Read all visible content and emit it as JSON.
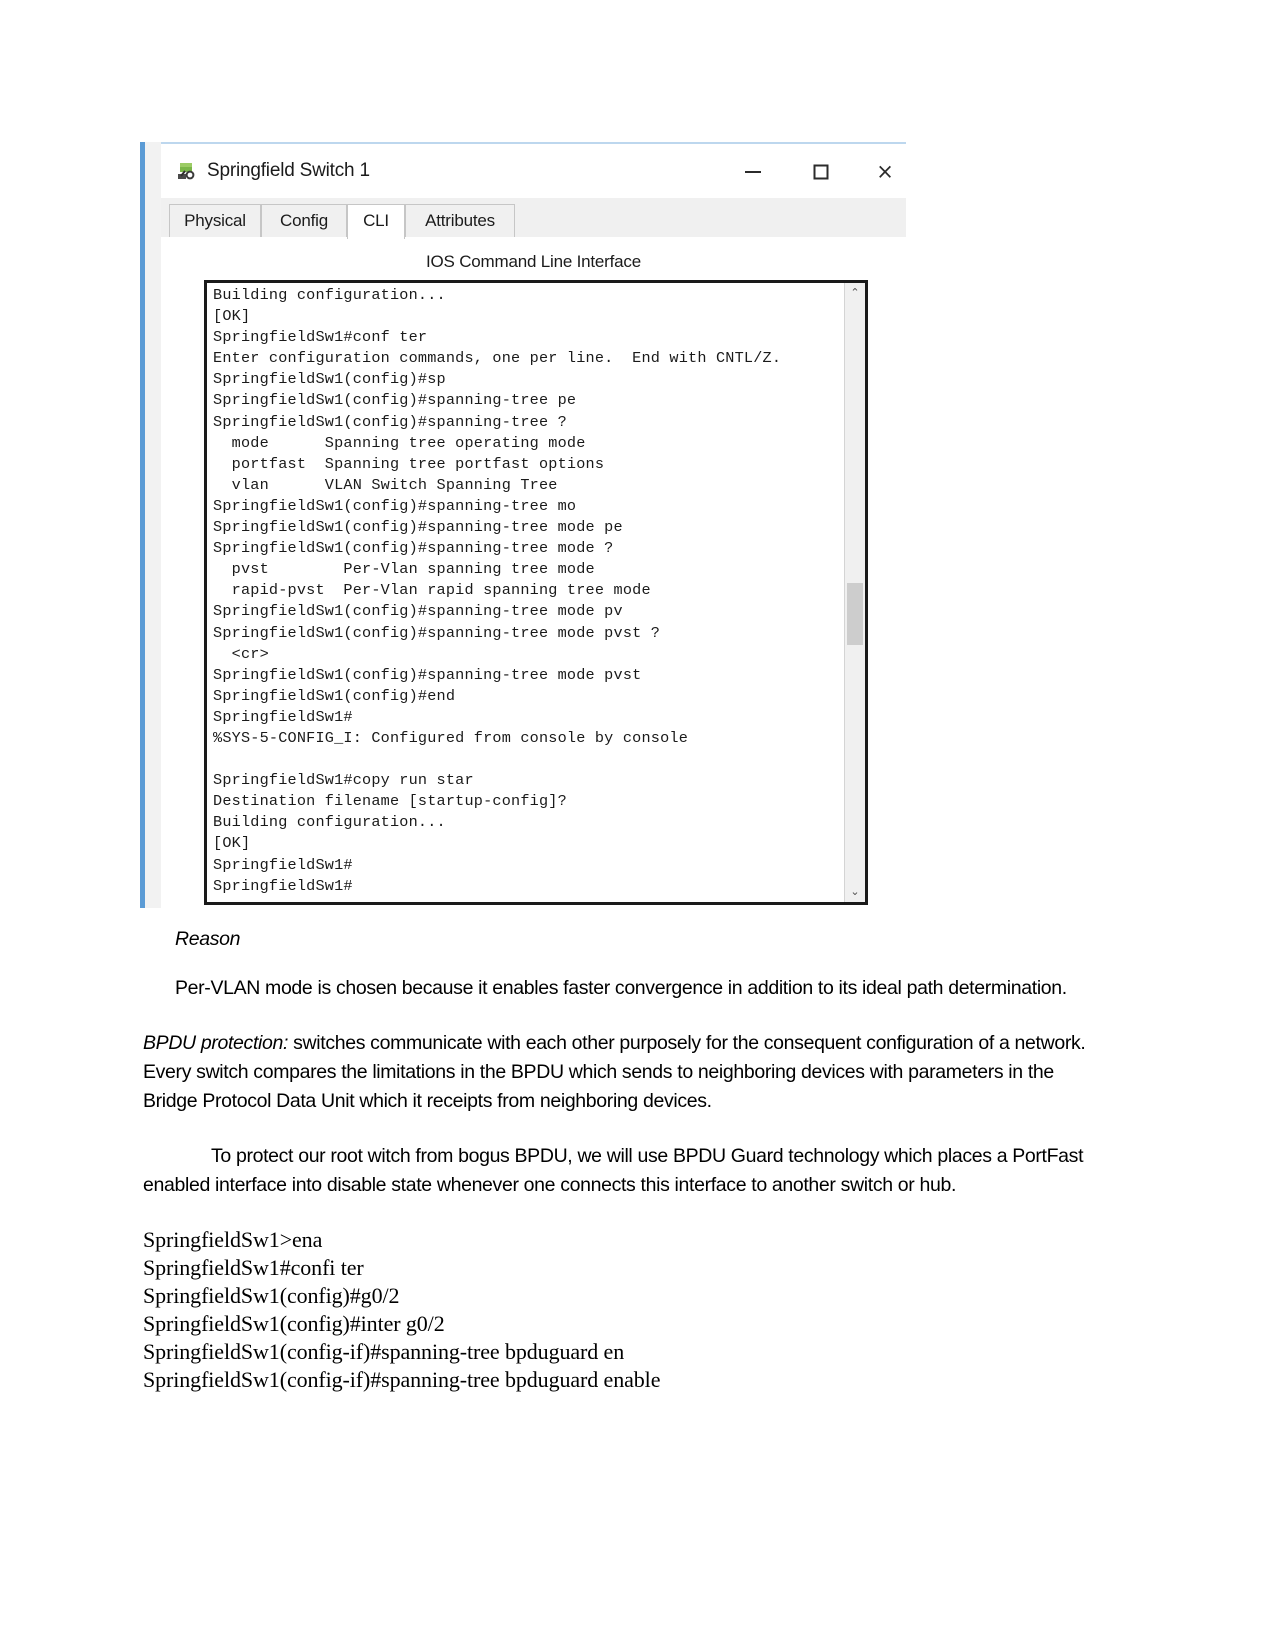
{
  "window": {
    "title": "Springfield Switch 1",
    "icon": "packet-tracer-switch-icon",
    "controls": {
      "minimize": "—",
      "maximize": "□",
      "close": "×"
    }
  },
  "tabs": [
    {
      "label": "Physical",
      "active": false
    },
    {
      "label": "Config",
      "active": false
    },
    {
      "label": "CLI",
      "active": true
    },
    {
      "label": "Attributes",
      "active": false
    }
  ],
  "cli": {
    "heading": "IOS Command Line Interface",
    "scrollbar": {
      "up_arrow": "⌃",
      "down_arrow": "⌄"
    },
    "output": "Building configuration...\n[OK]\nSpringfieldSw1#conf ter\nEnter configuration commands, one per line.  End with CNTL/Z.\nSpringfieldSw1(config)#sp\nSpringfieldSw1(config)#spanning-tree pe\nSpringfieldSw1(config)#spanning-tree ?\n  mode      Spanning tree operating mode\n  portfast  Spanning tree portfast options\n  vlan      VLAN Switch Spanning Tree\nSpringfieldSw1(config)#spanning-tree mo\nSpringfieldSw1(config)#spanning-tree mode pe\nSpringfieldSw1(config)#spanning-tree mode ?\n  pvst        Per-Vlan spanning tree mode\n  rapid-pvst  Per-Vlan rapid spanning tree mode\nSpringfieldSw1(config)#spanning-tree mode pv\nSpringfieldSw1(config)#spanning-tree mode pvst ?\n  <cr>\nSpringfieldSw1(config)#spanning-tree mode pvst\nSpringfieldSw1(config)#end\nSpringfieldSw1#\n%SYS-5-CONFIG_I: Configured from console by console\n\nSpringfieldSw1#copy run star\nDestination filename [startup-config]?\nBuilding configuration...\n[OK]\nSpringfieldSw1#\nSpringfieldSw1#"
  },
  "document": {
    "reason_heading": "Reason",
    "reason_body": "Per-VLAN mode is chosen because it enables faster convergence in addition to its ideal path determination.",
    "bpdu_term": "BPDU protection:",
    "bpdu_body": " switches communicate with each other purposely for the consequent configuration of a network. Every switch compares the limitations in the BPDU which sends to neighboring devices with parameters in the Bridge Protocol Data Unit which it receipts from neighboring devices.",
    "protect_paragraph": "To protect our root witch from bogus BPDU, we will use BPDU Guard technology which places a PortFast enabled interface into disable state whenever one connects this interface to another switch or hub.",
    "command_lines": "SpringfieldSw1>ena\nSpringfieldSw1#confi ter\nSpringfieldSw1(config)#g0/2\nSpringfieldSw1(config)#inter g0/2\nSpringfieldSw1(config-if)#spanning-tree bpduguard en\nSpringfieldSw1(config-if)#spanning-tree bpduguard enable"
  }
}
